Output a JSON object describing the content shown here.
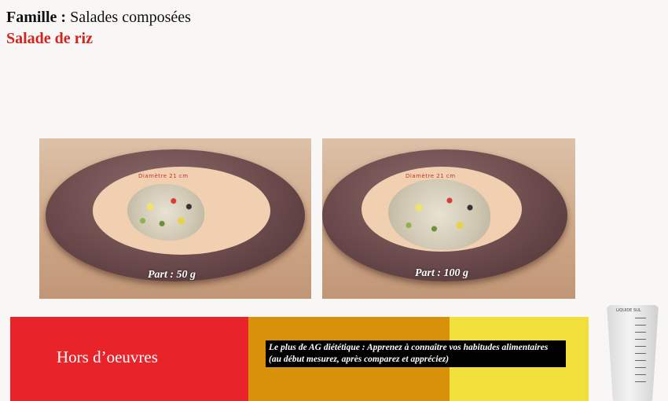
{
  "header": {
    "famille_label": "Famille : ",
    "famille_value": "Salades composées",
    "recipe_title": "Salade de riz"
  },
  "portions": [
    {
      "plate_text": "Diamètre 21 cm",
      "label": "Part : 50 g"
    },
    {
      "plate_text": "Diamètre 21 cm",
      "label": "Part : 100 g"
    }
  ],
  "category": "Hors d’oeuvres",
  "tip": "Le plus de AG diététique : Apprenez à connaître vos habitudes alimentaires (au début mesurez, après comparez et appréciez)",
  "cup": {
    "label": "LIQUIDE   SUL"
  },
  "colors": {
    "red": "#e8232a",
    "orange": "#d8920a",
    "yellow": "#f1df3b",
    "title_red": "#d4221c"
  }
}
